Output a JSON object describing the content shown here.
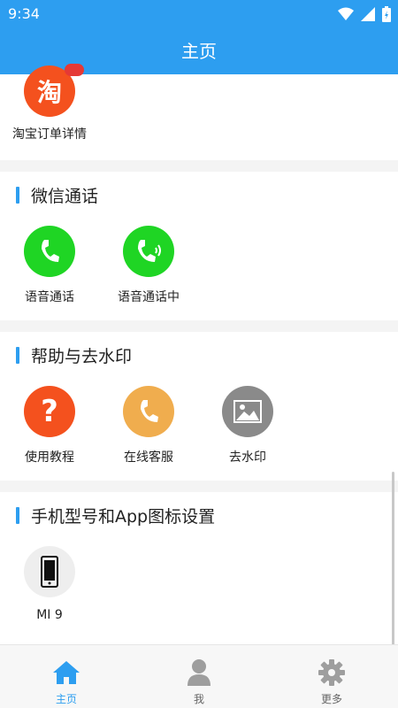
{
  "status": {
    "time": "9:34"
  },
  "app_bar": {
    "title": "主页"
  },
  "top_item": {
    "label": "淘宝订单详情",
    "icon_text": "淘",
    "badge_color": "#e53935",
    "icon_color": "#f4511e"
  },
  "sections": [
    {
      "title": "微信通话",
      "items": [
        {
          "label": "语音通话",
          "icon": "phone-icon",
          "color": "#1fd524"
        },
        {
          "label": "语音通话中",
          "icon": "phone-calling-icon",
          "color": "#1fd524"
        }
      ]
    },
    {
      "title": "帮助与去水印",
      "items": [
        {
          "label": "使用教程",
          "icon": "question-icon",
          "color": "#f4511e"
        },
        {
          "label": "在线客服",
          "icon": "phone-icon",
          "color": "#f0ad4e"
        },
        {
          "label": "去水印",
          "icon": "image-icon",
          "color": "#8a8a8a"
        }
      ]
    },
    {
      "title": "手机型号和App图标设置",
      "items": [
        {
          "label": "MI 9",
          "icon": "smartphone-icon",
          "color": "#eeeeee"
        }
      ]
    }
  ],
  "bottom_nav": [
    {
      "label": "主页",
      "icon": "home-icon",
      "active": true
    },
    {
      "label": "我",
      "icon": "person-icon",
      "active": false
    },
    {
      "label": "更多",
      "icon": "gear-icon",
      "active": false
    }
  ],
  "colors": {
    "primary": "#2d9ef0",
    "inactive": "#9e9e9e"
  }
}
